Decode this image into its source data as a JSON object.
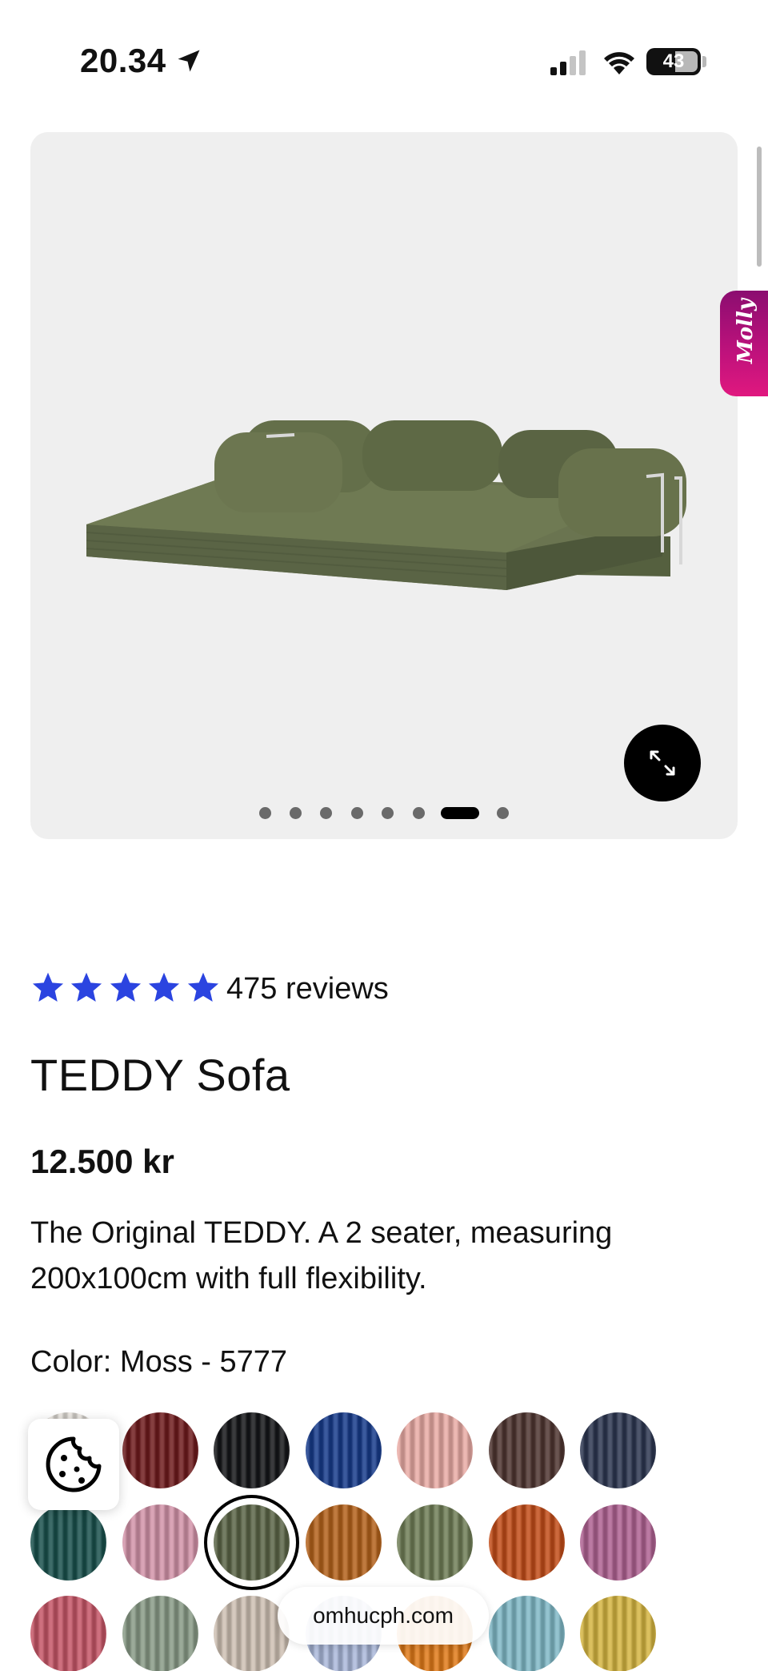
{
  "status_bar": {
    "time": "20.34",
    "battery": "43"
  },
  "gallery": {
    "image_count": 8,
    "active_index": 6,
    "expand_icon": "expand-icon"
  },
  "assistant_tab": {
    "label": "Molly"
  },
  "product": {
    "rating_stars": 5,
    "star_color": "#2b44e0",
    "reviews": "475 reviews",
    "title": "TEDDY Sofa",
    "price": "12.500 kr",
    "description": "The Original TEDDY. A 2 seater, measuring 200x100cm with full flexibility.",
    "color_label": "Color: Moss - 5777"
  },
  "swatches": [
    {
      "name": "cream",
      "color": "#e8e4de"
    },
    {
      "name": "burgundy",
      "color": "#6e1a1c"
    },
    {
      "name": "black",
      "color": "#141518"
    },
    {
      "name": "royal-blue",
      "color": "#163a8a"
    },
    {
      "name": "blush",
      "color": "#e8aaa4"
    },
    {
      "name": "chocolate",
      "color": "#4e3430"
    },
    {
      "name": "navy",
      "color": "#2c3650"
    },
    {
      "name": "teal",
      "color": "#19504c"
    },
    {
      "name": "rose",
      "color": "#d293a8"
    },
    {
      "name": "moss",
      "color": "#5a6446",
      "selected": true
    },
    {
      "name": "ochre",
      "color": "#b3611a"
    },
    {
      "name": "sage",
      "color": "#6f7d56"
    },
    {
      "name": "rust",
      "color": "#c24c18"
    },
    {
      "name": "mauve",
      "color": "#ae6191"
    },
    {
      "name": "raspberry",
      "color": "#c55566"
    },
    {
      "name": "eucalyptus",
      "color": "#889a86"
    },
    {
      "name": "sand",
      "color": "#cdbfb2"
    },
    {
      "name": "sky",
      "color": "#aab8da"
    },
    {
      "name": "orange",
      "color": "#e07a18"
    },
    {
      "name": "aqua",
      "color": "#7fb8c6"
    },
    {
      "name": "mustard",
      "color": "#d4b440"
    }
  ],
  "browser": {
    "url": "omhucph.com",
    "cookie_icon": "cookie-icon"
  }
}
